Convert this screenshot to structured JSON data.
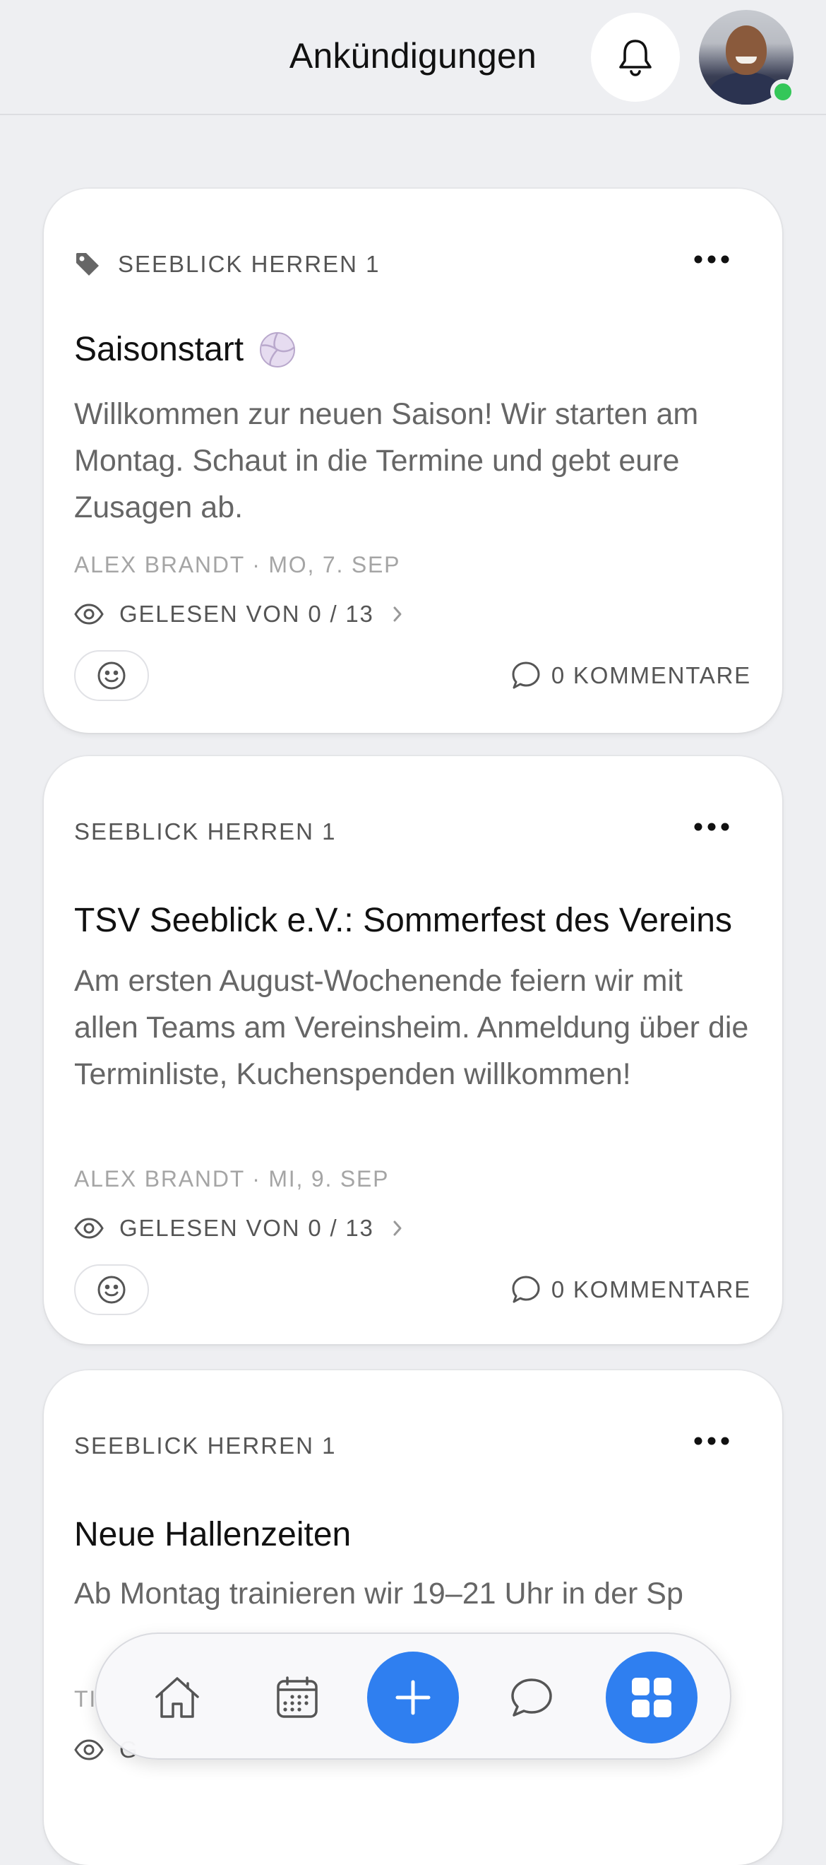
{
  "header": {
    "title": "Ankündigungen"
  },
  "posts": [
    {
      "team": "SEEBLICK HERREN 1",
      "title": "Saisonstart",
      "body": "Willkommen zur neuen Saison! Wir starten am Montag. Schaut in die Termine und gebt eure Zusagen ab.",
      "meta": "ALEX BRANDT · MO, 7. SEP",
      "read": "GELESEN VON 0 / 13",
      "comments": "0 KOMMENTARE"
    },
    {
      "team": "SEEBLICK HERREN 1",
      "title": "TSV Seeblick e.V.: Sommerfest des Vereins",
      "body": "Am ersten August-Wochenende feiern wir mit allen Teams am Vereinsheim. Anmeldung über die Terminliste, Kuchenspenden willkommen!",
      "meta": "ALEX BRANDT · MI, 9. SEP",
      "read": "GELESEN VON 0 / 13",
      "comments": "0 KOMMENTARE"
    },
    {
      "team": "SEEBLICK HERREN 1",
      "title": "Neue Hallenzeiten",
      "body": "Ab Montag trainieren wir 19–21 Uhr in der Sp",
      "meta": "TI",
      "read": "G"
    }
  ],
  "tabbar": {
    "items": [
      "home-icon",
      "calendar-icon",
      "plus-icon",
      "chat-icon",
      "grid-icon"
    ],
    "accent": "#2f7ff0"
  },
  "colors": {
    "background": "#eeeff2",
    "online": "#34c759"
  }
}
